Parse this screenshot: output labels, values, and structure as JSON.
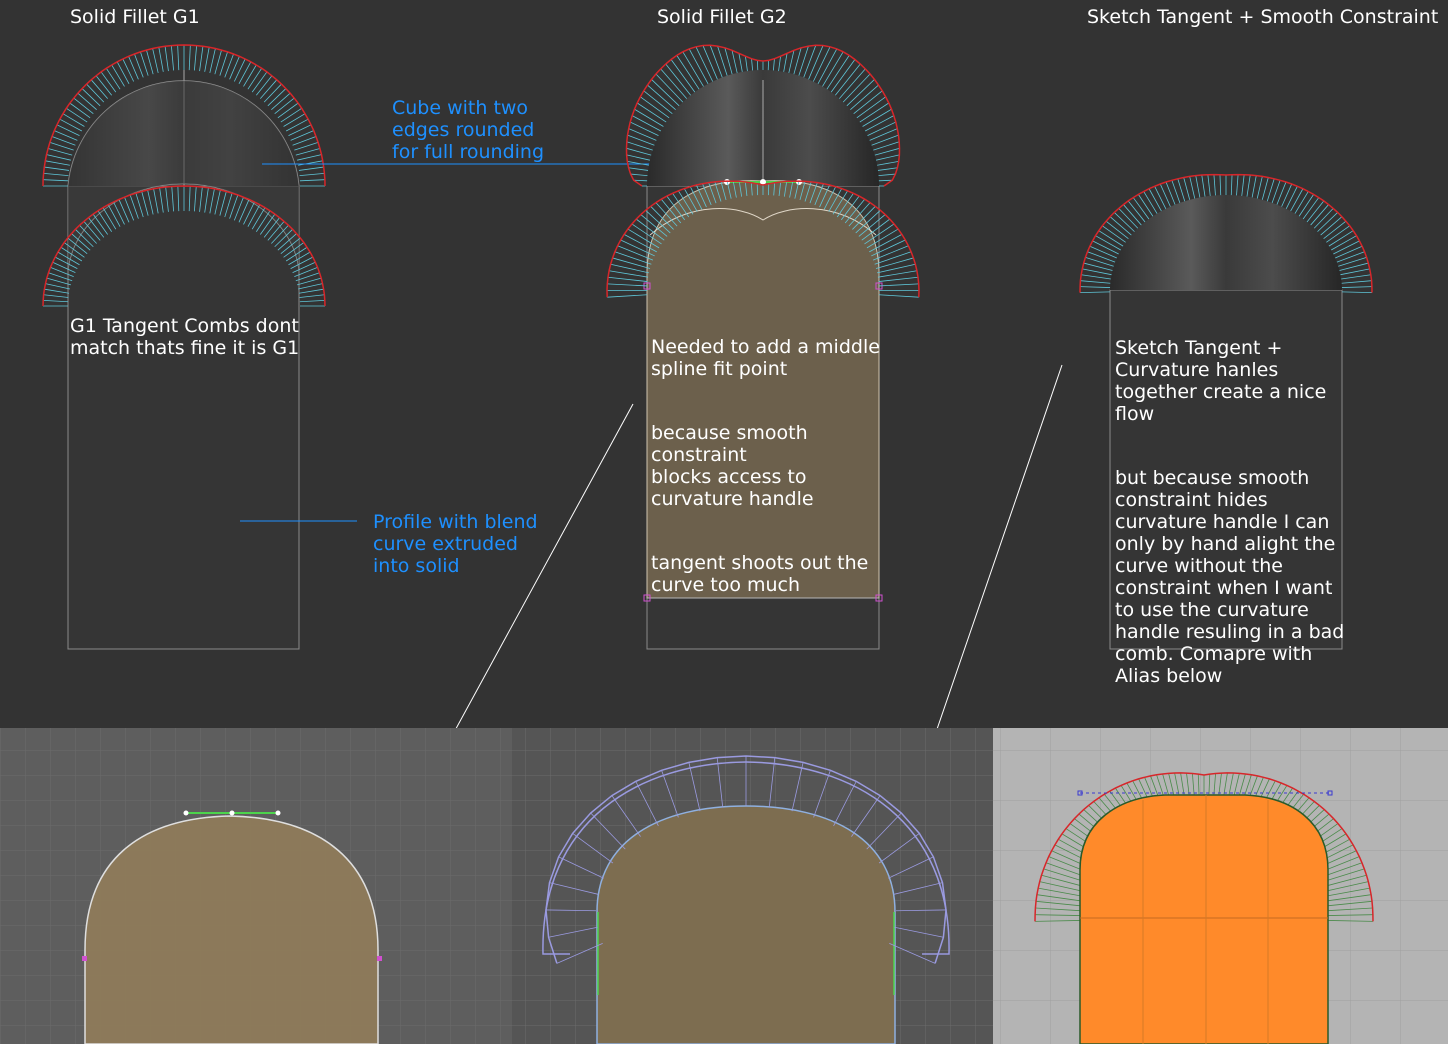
{
  "titles": {
    "g1": "Solid Fillet G1",
    "g2": "Solid Fillet G2",
    "sketch": "Sketch  Tangent + Smooth Constraint"
  },
  "annotations": {
    "cube": "Cube with two\nedges rounded\nfor full rounding",
    "profile": "Profile with blend\ncurve extruded\ninto solid",
    "g1_note": "G1 Tangent Combs dont\nmatch thats fine it is G1",
    "g2_note_1": "Needed to add a middle\nspline fit point",
    "g2_note_2": "because smooth\nconstraint\nblocks access to\ncurvature handle",
    "g2_note_3": "tangent shoots out the\ncurve too much",
    "sketch_note_1": "Sketch  Tangent +\nCurvature hanles\ntogether create a nice\nflow",
    "sketch_note_2": "but because smooth\nconstraint hides\ncurvature handle I can\nonly by hand alight the\ncurve without the\nconstraint when I want\nto use the curvature\nhandle resuling in a bad\ncomb. Comapre with\nAlias below"
  },
  "colors": {
    "background": "#333333",
    "annotation_blue": "#1e90ff",
    "comb_red": "#d8262a",
    "comb_cyan": "#5fc6d8",
    "profile_fill": "#8f7b5a",
    "alias_orange": "#ff8a2a",
    "alias_bg": "#b4b4b4"
  }
}
